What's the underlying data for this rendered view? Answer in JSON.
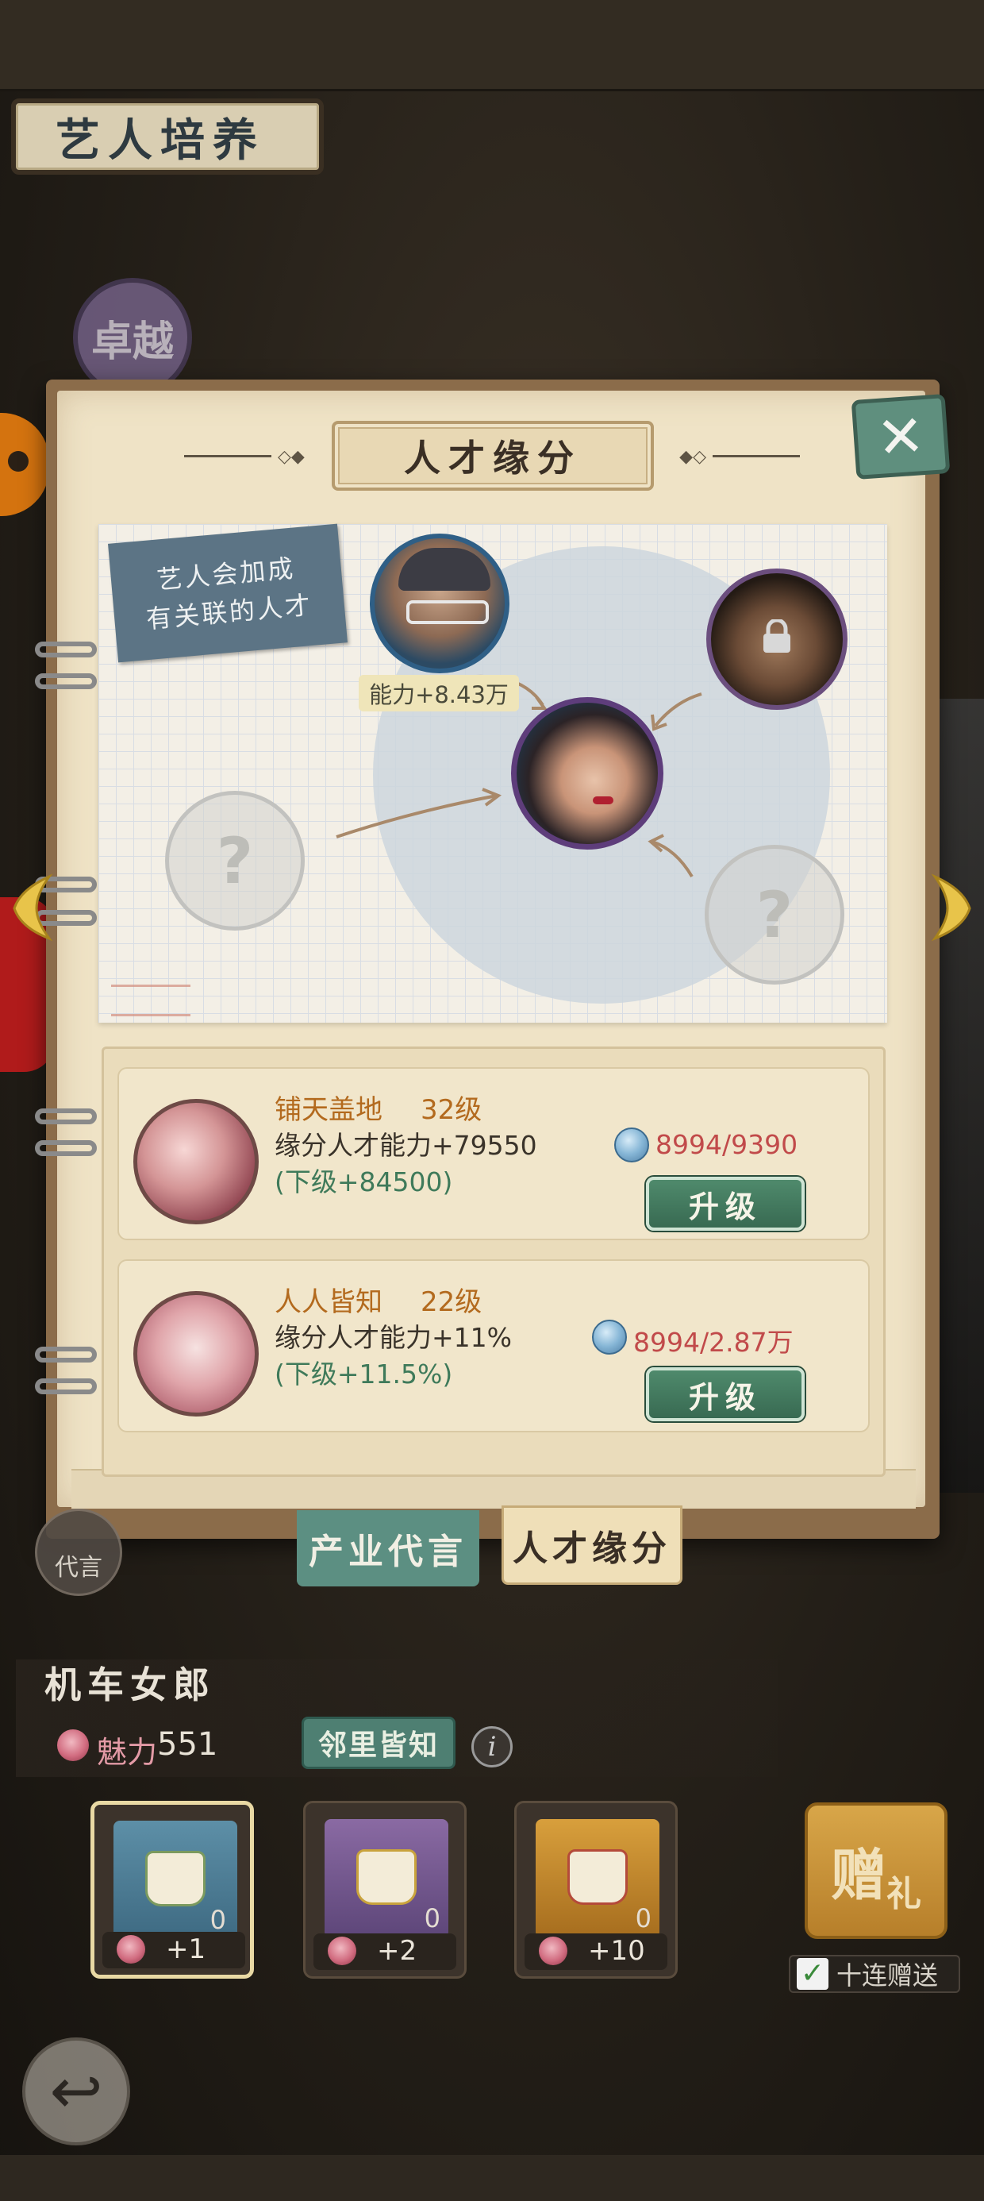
{
  "header": {
    "title": "艺人培养"
  },
  "rank_badge": "卓越",
  "dialog": {
    "title": "人才缘分",
    "close_symbol": "✕",
    "note": {
      "line1": "艺人会加成",
      "line2": "有关联的人才"
    },
    "power_bonus": "能力+8.43万",
    "unknown_symbol": "?"
  },
  "bonds": [
    {
      "name": "铺天盖地",
      "level": "32级",
      "effect": "缘分人才能力+79550",
      "next": "(下级+84500)",
      "cost": "8994/9390",
      "button": "升级"
    },
    {
      "name": "人人皆知",
      "level": "22级",
      "effect": "缘分人才能力+11%",
      "next": "(下级+11.5%)",
      "cost": "8994/2.87万",
      "button": "升级"
    }
  ],
  "tabs": [
    {
      "label": "产业代言",
      "active": false
    },
    {
      "label": "人才缘分",
      "active": true
    }
  ],
  "side_button": "代言",
  "character": {
    "name": "机车女郎",
    "charm_label": "魅力",
    "charm_value": "551",
    "tag": "邻里皆知",
    "info_symbol": "i"
  },
  "items": [
    {
      "count": "0",
      "bonus": "+1",
      "selected": true
    },
    {
      "count": "0",
      "bonus": "+2",
      "selected": false
    },
    {
      "count": "0",
      "bonus": "+10",
      "selected": false
    }
  ],
  "gift": {
    "char1": "赠",
    "char2": "礼",
    "ten_label": "十连赠送",
    "ten_checked": true,
    "check_symbol": "✓"
  },
  "back_symbol": "↩",
  "colors": {
    "accent_green": "#4f8a6c",
    "cost_red": "#c14a4a",
    "name_orange": "#b36a1e",
    "next_green": "#3f7a5a"
  }
}
